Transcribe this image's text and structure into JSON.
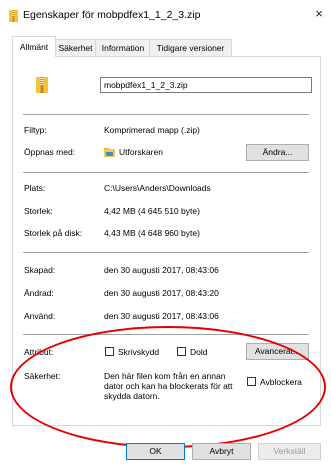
{
  "window": {
    "title": "Egenskaper för mobpdfex1_1_2_3.zip",
    "close_glyph": "×"
  },
  "tabs": [
    {
      "label": "Allmänt",
      "active": true
    },
    {
      "label": "Säkerhet",
      "active": false
    },
    {
      "label": "Information",
      "active": false
    },
    {
      "label": "Tidigare versioner",
      "active": false
    }
  ],
  "general": {
    "file_name": "mobpdfex1_1_2_3.zip",
    "file_type_label": "Filtyp:",
    "file_type_value": "Komprimerad mapp (.zip)",
    "opens_with_label": "Öppnas med:",
    "opens_with_value": "Utforskaren",
    "change_button": "Ändra...",
    "location_label": "Plats:",
    "location_value": "C:\\Users\\Anders\\Downloads",
    "size_label": "Storlek:",
    "size_value": "4,42 MB (4 645 510 byte)",
    "size_on_disk_label": "Storlek på disk:",
    "size_on_disk_value": "4,43 MB (4 648 960 byte)",
    "created_label": "Skapad:",
    "created_value": "den 30 augusti 2017, 08:43:06",
    "modified_label": "Ändrad:",
    "modified_value": "den 30 augusti 2017, 08:43:20",
    "accessed_label": "Använd:",
    "accessed_value": "den 30 augusti 2017, 08:43:06",
    "attributes_label": "Attribut:",
    "readonly_label": "Skrivskydd",
    "readonly_checked": false,
    "hidden_label": "Dold",
    "hidden_checked": false,
    "advanced_button": "Avancerat...",
    "security_label": "Säkerhet:",
    "security_text": "Den här filen kom från en annan dator och kan ha blockerats för att skydda datorn.",
    "unblock_label": "Avblockera",
    "unblock_checked": false
  },
  "footer": {
    "ok": "OK",
    "cancel": "Avbryt",
    "apply": "Verkställ"
  },
  "colors": {
    "highlight_ellipse": "#e60000",
    "primary_border": "#0078d7"
  }
}
